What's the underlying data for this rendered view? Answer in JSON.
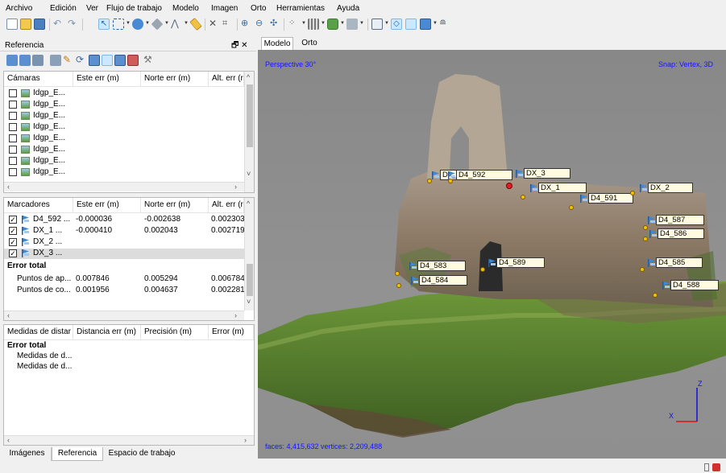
{
  "menu": [
    "Archivo",
    "Edición",
    "Ver",
    "Flujo de trabajo",
    "Modelo",
    "Imagen",
    "Orto",
    "Herramientas",
    "Ayuda"
  ],
  "reference_panel": {
    "title": "Referencia",
    "controls": "🗗 ✕",
    "cameras": {
      "headers": [
        "Cámaras",
        "Este err (m)",
        "Norte err (m)",
        "Alt. err (r"
      ],
      "rows": [
        "Idgp_E...",
        "Idgp_E...",
        "Idgp_E...",
        "Idgp_E...",
        "Idgp_E...",
        "Idgp_E...",
        "Idgp_E...",
        "Idgp_E..."
      ]
    },
    "markers": {
      "headers": [
        "Marcadores",
        "Este err (m)",
        "Norte err (m)",
        "Alt. err (r"
      ],
      "rows": [
        {
          "name": "D4_592 ...",
          "east": "-0.000036",
          "north": "-0.002638",
          "alt": "0.002303"
        },
        {
          "name": "DX_1    ...",
          "east": "-0.000410",
          "north": "0.002043",
          "alt": "0.002719"
        },
        {
          "name": "DX_2    ...",
          "east": "",
          "north": "",
          "alt": ""
        },
        {
          "name": "DX_3    ...",
          "east": "",
          "north": "",
          "alt": ""
        }
      ],
      "total_label": "Error total",
      "totals": [
        {
          "name": "Puntos de ap...",
          "east": "0.007846",
          "north": "0.005294",
          "alt": "0.006784"
        },
        {
          "name": "Puntos de co...",
          "east": "0.001956",
          "north": "0.004637",
          "alt": "0.002281"
        }
      ]
    },
    "distances": {
      "headers": [
        "Medidas de distar",
        "Distancia err (m)",
        "Precisión (m)",
        "Error (m)"
      ],
      "total_label": "Error total",
      "rows": [
        "Medidas de d...",
        "Medidas de d..."
      ]
    }
  },
  "bottom_tabs": [
    "Imágenes",
    "Referencia",
    "Espacio de trabajo"
  ],
  "viewport_tabs": [
    "Modelo",
    "Orto"
  ],
  "viewport": {
    "perspective": "Perspective 30°",
    "snap": "Snap: Vertex, 3D",
    "stats": "faces: 4,415,632 vertices: 2,209,488",
    "axes": {
      "z": "Z",
      "x": "X"
    },
    "markers": [
      "D4_",
      "D4_592",
      "DX_3",
      "DX_1",
      "D4_591",
      "DX_2",
      "D4_587",
      "D4_586",
      "D4_589",
      "D4_583",
      "D4_584",
      "D4_585",
      "D4_588"
    ]
  },
  "colors": {
    "selection": "#cce8ff",
    "viewport_text": "#1414ff",
    "marker_bg": "#fffbe0",
    "axis_red": "#e01010",
    "axis_blue": "#1010e0"
  }
}
